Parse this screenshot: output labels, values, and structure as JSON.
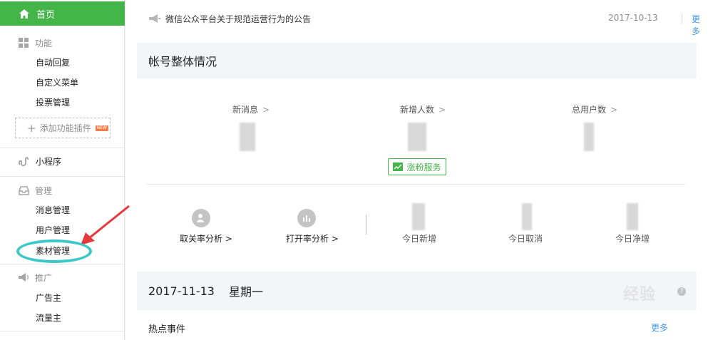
{
  "sidebar": {
    "home": "首页",
    "sections": {
      "function": {
        "title": "功能",
        "items": [
          "自动回复",
          "自定义菜单",
          "投票管理"
        ],
        "plugin": "添加功能插件",
        "plugin_badge": "NEW"
      },
      "mini_program": {
        "title": "小程序"
      },
      "manage": {
        "title": "管理",
        "items": [
          "消息管理",
          "用户管理",
          "素材管理"
        ]
      },
      "promote": {
        "title": "推广",
        "items": [
          "广告主",
          "流量主"
        ]
      }
    }
  },
  "notice": {
    "text": "微信公众平台关于规范运营行为的公告",
    "date": "2017-10-13",
    "more": "更多"
  },
  "account": {
    "title": "帐号整体情况",
    "stats": [
      {
        "label": "新消息"
      },
      {
        "label": "新增人数"
      },
      {
        "label": "总用户数"
      }
    ],
    "chevron": ">",
    "grow_button": "涨粉服务",
    "analysis": [
      {
        "label": "取关率分析 >"
      },
      {
        "label": "打开率分析 >"
      }
    ],
    "today": [
      "今日新增",
      "今日取消",
      "今日净增"
    ]
  },
  "daily": {
    "date": "2017-11-13",
    "weekday": "星期一",
    "help": "?"
  },
  "hot": {
    "title": "热点事件",
    "more": "更多"
  },
  "colors": {
    "accent": "#44b549",
    "link": "#459ae9",
    "annotation": "#3cc8c9",
    "arrow": "#e4393c"
  }
}
